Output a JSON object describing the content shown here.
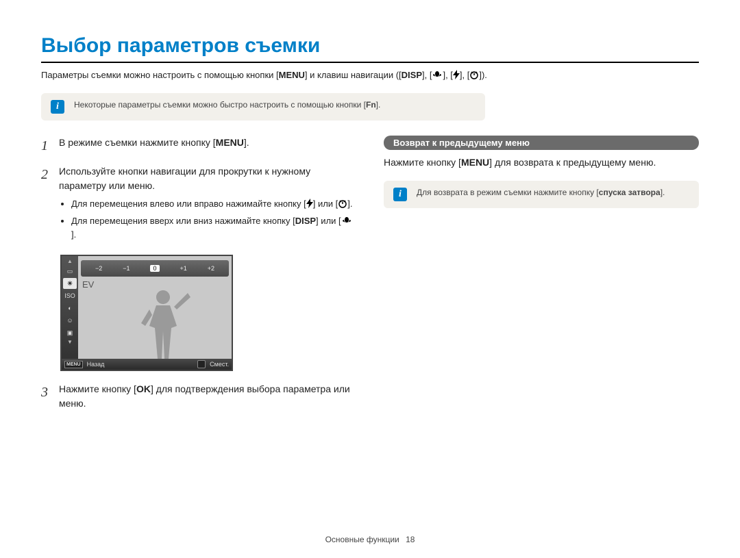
{
  "title": "Выбор параметров съемки",
  "intro": {
    "prefix": "Параметры съемки можно настроить с помощью кнопки [",
    "menu": "MENU",
    "mid": "] и клавиш навигации ([",
    "disp": "DISP",
    "sep": "], [",
    "end": "])."
  },
  "note_top": {
    "text_prefix": "Некоторые параметры съемки можно быстро настроить с помощью кнопки [",
    "fn": "Fn",
    "text_suffix": "]."
  },
  "steps": {
    "s1": {
      "num": "1",
      "prefix": "В режиме съемки нажмите кнопку [",
      "menu": "MENU",
      "suffix": "]."
    },
    "s2": {
      "num": "2",
      "text": "Используйте кнопки навигации для прокрутки к нужному параметру или меню.",
      "b1_prefix": "Для перемещения влево или вправо нажимайте кнопку [",
      "b1_mid": "] или [",
      "b1_suffix": "].",
      "b2_prefix": "Для перемещения вверх или вниз нажимайте кнопку [",
      "b2_disp": "DISP",
      "b2_mid": "] или [",
      "b2_suffix": "]."
    },
    "s3": {
      "num": "3",
      "prefix": "Нажмите кнопку [",
      "ok": "OK",
      "suffix": "] для подтверждения выбора параметра или меню."
    }
  },
  "screen": {
    "ev_ticks": [
      "−2",
      "−1",
      "0",
      "+1",
      "+2"
    ],
    "ev_label": "EV",
    "side_sel": "☀",
    "side_iso": "ISO",
    "footer_menu": "MENU",
    "footer_back": "Назад",
    "footer_move": "Смест."
  },
  "right": {
    "heading": "Возврат к предыдущему меню",
    "text_prefix": "Нажмите кнопку [",
    "menu": "MENU",
    "text_suffix": "] для возврата к предыдущему меню.",
    "note_prefix": "Для возврата в режим съемки нажмите кнопку [",
    "note_bold": "спуска затвора",
    "note_suffix": "]."
  },
  "footer": {
    "section": "Основные функции",
    "page": "18"
  }
}
